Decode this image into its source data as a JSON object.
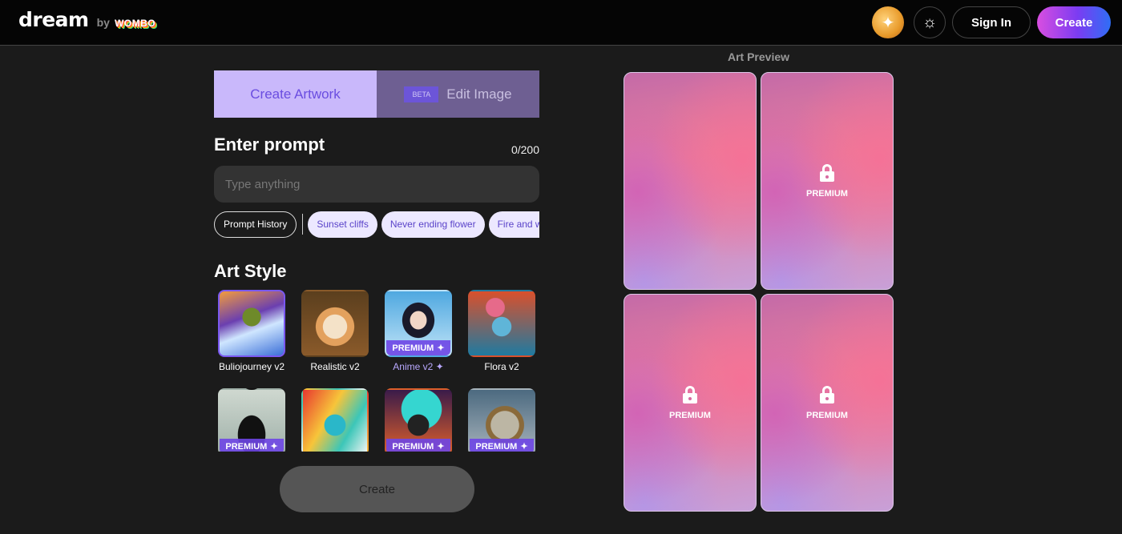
{
  "header": {
    "logo": "dream",
    "logo_by": "by",
    "logo_brand": "WOMBO",
    "avatar_icon": "sparkle-avatar-icon",
    "theme_icon": "sun-icon",
    "signin_label": "Sign In",
    "create_label": "Create",
    "create_gradient": [
      "#d94ee0",
      "#7b3cf2",
      "#2f6ef5"
    ]
  },
  "tabs": [
    {
      "label": "Create Artwork",
      "active": true
    },
    {
      "label": "Edit Image",
      "badge": "BETA",
      "active": false
    }
  ],
  "prompt": {
    "title": "Enter prompt",
    "char_count": "0/200",
    "value": "",
    "placeholder": "Type anything"
  },
  "chips": {
    "history_label": "Prompt History",
    "suggestions": [
      "Sunset cliffs",
      "Never ending flower",
      "Fire and water"
    ]
  },
  "art_style": {
    "title": "Art Style",
    "premium_label": "PREMIUM",
    "styles": [
      {
        "label": "Buliojourney v2",
        "premium": false,
        "selected": true
      },
      {
        "label": "Realistic v2",
        "premium": false,
        "selected": false
      },
      {
        "label": "Anime v2",
        "premium": true,
        "selected": false
      },
      {
        "label": "Flora v2",
        "premium": false,
        "selected": false
      },
      {
        "label": "",
        "premium": true,
        "selected": false
      },
      {
        "label": "",
        "premium": false,
        "selected": false
      },
      {
        "label": "",
        "premium": true,
        "selected": false
      },
      {
        "label": "",
        "premium": true,
        "selected": false
      }
    ]
  },
  "create_button": {
    "label": "Create"
  },
  "preview": {
    "title": "Art Preview",
    "cards": [
      {
        "locked": false,
        "label": ""
      },
      {
        "locked": true,
        "label": "PREMIUM"
      },
      {
        "locked": true,
        "label": "PREMIUM"
      },
      {
        "locked": true,
        "label": "PREMIUM"
      }
    ]
  },
  "colors": {
    "accent": "#7a58f0",
    "tab_active_bg": "#c9b8fb",
    "tab_inactive_bg": "#6e5f92",
    "chip_bg": "#ece8ff",
    "background": "#1b1b1b"
  }
}
